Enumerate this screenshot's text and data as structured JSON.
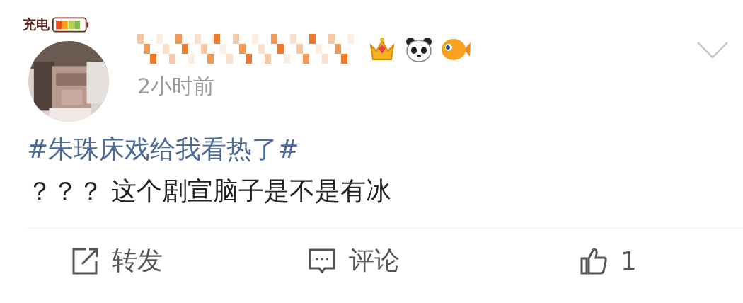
{
  "post": {
    "author_badge": "充电",
    "time": "2小时前",
    "hashtag": "#朱珠床戏给我看热了#",
    "text": "？？？ 这个剧宣脑子是不是有冰"
  },
  "actions": [
    {
      "kind": "repost",
      "label": "转发"
    },
    {
      "kind": "comment",
      "label": "评论"
    },
    {
      "kind": "like",
      "label": "1"
    }
  ]
}
